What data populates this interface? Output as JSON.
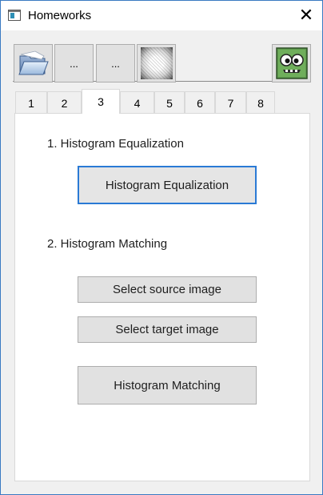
{
  "window": {
    "title": "Homeworks",
    "close_glyph": "✕"
  },
  "toolbar": {
    "open_icon": "folder-open-icon",
    "button2_label": "...",
    "button3_label": "...",
    "gradient_icon": "gradient-noise-icon",
    "monster_icon": "green-monster-icon"
  },
  "tabs": [
    {
      "label": "1",
      "active": false
    },
    {
      "label": "2",
      "active": false
    },
    {
      "label": "3",
      "active": true
    },
    {
      "label": "4",
      "active": false
    },
    {
      "label": "5",
      "active": false
    },
    {
      "label": "6",
      "active": false
    },
    {
      "label": "7",
      "active": false
    },
    {
      "label": "8",
      "active": false
    }
  ],
  "section1": {
    "heading": "1. Histogram Equalization",
    "button_label": "Histogram Equalization"
  },
  "section2": {
    "heading": "2. Histogram Matching",
    "select_source_label": "Select source image",
    "select_target_label": "Select target image",
    "matching_label": "Histogram Matching"
  },
  "colors": {
    "focus_border": "#2a7ad5",
    "button_face": "#e1e1e1",
    "window_border": "#3a7ac2"
  }
}
